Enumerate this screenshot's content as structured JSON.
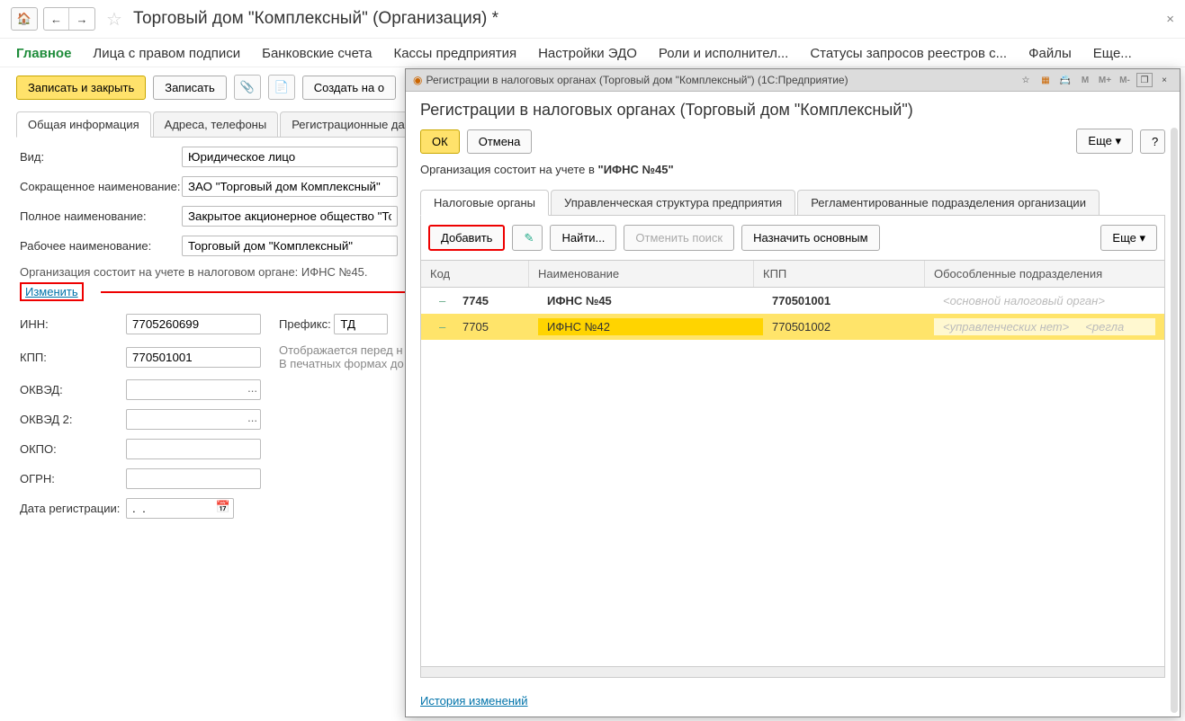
{
  "page_title": "Торговый дом \"Комплексный\" (Организация) *",
  "main_nav": {
    "main": "Главное",
    "signers": "Лица с правом подписи",
    "bank": "Банковские счета",
    "cash": "Кассы предприятия",
    "edo": "Настройки ЭДО",
    "roles": "Роли и исполнител...",
    "statuses": "Статусы запросов реестров с...",
    "files": "Файлы",
    "more": "Еще..."
  },
  "toolbar": {
    "save_close": "Записать и закрыть",
    "save": "Записать",
    "create_on": "Создать на о"
  },
  "sub_tabs": {
    "general": "Общая информация",
    "addresses": "Адреса, телефоны",
    "reg": "Регистрационные данн"
  },
  "form": {
    "kind_lbl": "Вид:",
    "kind_val": "Юридическое лицо",
    "short_lbl": "Сокращенное наименование:",
    "short_val": "ЗАО \"Торговый дом Комплексный\"",
    "full_lbl": "Полное наименование:",
    "full_val": "Закрытое акционерное общество \"Торг",
    "work_lbl": "Рабочее наименование:",
    "work_val": "Торговый дом \"Комплексный\"",
    "tax_line": "Организация состоит на учете в налоговом органе: ИФНС №45.",
    "change": "Изменить",
    "inn_lbl": "ИНН:",
    "inn_val": "7705260699",
    "prefix_lbl": "Префикс:",
    "prefix_val": "ТД",
    "prefix_hint1": "Отображается перед н",
    "prefix_hint2": "В печатных формах до",
    "kpp_lbl": "КПП:",
    "kpp_val": "770501001",
    "okved_lbl": "ОКВЭД:",
    "okved2_lbl": "ОКВЭД 2:",
    "okpo_lbl": "ОКПО:",
    "ogrn_lbl": "ОГРН:",
    "regdate_lbl": "Дата регистрации:",
    "regdate_val": ".  .    "
  },
  "dialog": {
    "win_title": "Регистрации в налоговых органах (Торговый дом \"Комплексный\")  (1С:Предприятие)",
    "title": "Регистрации в налоговых органах (Торговый дом \"Комплексный\")",
    "ok": "ОК",
    "cancel": "Отмена",
    "more": "Еще",
    "help": "?",
    "org_line_a": "Организация состоит на учете в ",
    "org_line_b": "\"ИФНС №45\"",
    "tabs": {
      "tax": "Налоговые органы",
      "mgmt": "Управленческая структура предприятия",
      "reg": "Регламентированные подразделения организации"
    },
    "tool": {
      "add": "Добавить",
      "find": "Найти...",
      "cancel_find": "Отменить поиск",
      "assign_main": "Назначить основным",
      "more": "Еще"
    },
    "head": {
      "code": "Код",
      "name": "Наименование",
      "kpp": "КПП",
      "sep": "Обособленные подразделения"
    },
    "rows": [
      {
        "mark": "–",
        "code": "7745",
        "name": "ИФНС №45",
        "kpp": "770501001",
        "sep": "<основной налоговый орган>"
      },
      {
        "mark": "–",
        "code": "7705",
        "name": "ИФНС №42",
        "kpp": "770501002",
        "sep": "<управленческих нет>",
        "extra": "<регла",
        "selected": true
      }
    ],
    "history": "История изменений",
    "calc": {
      "m": "M",
      "mplus": "M+",
      "mminus": "M-"
    }
  }
}
